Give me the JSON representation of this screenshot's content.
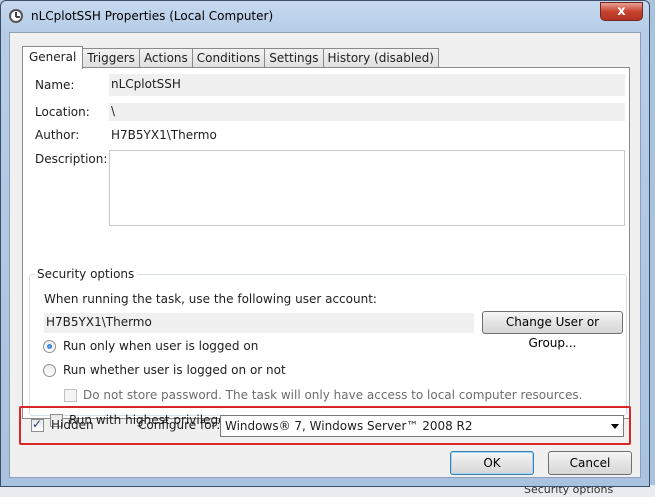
{
  "window": {
    "title": "nLCplotSSH Properties (Local Computer)",
    "close_glyph": "x"
  },
  "tabs": [
    {
      "label": "General",
      "active": true
    },
    {
      "label": "Triggers",
      "active": false
    },
    {
      "label": "Actions",
      "active": false
    },
    {
      "label": "Conditions",
      "active": false
    },
    {
      "label": "Settings",
      "active": false
    },
    {
      "label": "History (disabled)",
      "active": false
    }
  ],
  "general": {
    "name_label": "Name:",
    "name_value": "nLCplotSSH",
    "location_label": "Location:",
    "location_value": "\\",
    "author_label": "Author:",
    "author_value": "H7B5YX1\\Thermo",
    "description_label": "Description:"
  },
  "security": {
    "legend": "Security options",
    "account_prompt": "When running the task, use the following user account:",
    "account_value": "H7B5YX1\\Thermo",
    "change_button": "Change User or Group...",
    "radio_logged_on": "Run only when user is logged on",
    "radio_whether": "Run whether user is logged on or not",
    "no_store_password": "Do not store password.  The task will only have access to local computer resources.",
    "highest_privileges": "Run with highest privileges"
  },
  "bottom": {
    "hidden_label": "Hidden",
    "configure_label": "Configure for:",
    "configure_value": "Windows® 7, Windows Server™ 2008 R2"
  },
  "buttons": {
    "ok": "OK",
    "cancel": "Cancel"
  },
  "background_text": "Security options",
  "colors": {
    "highlight": "#d92626",
    "close_button": "#c7432f",
    "radio_selected": "#1a61c0"
  }
}
